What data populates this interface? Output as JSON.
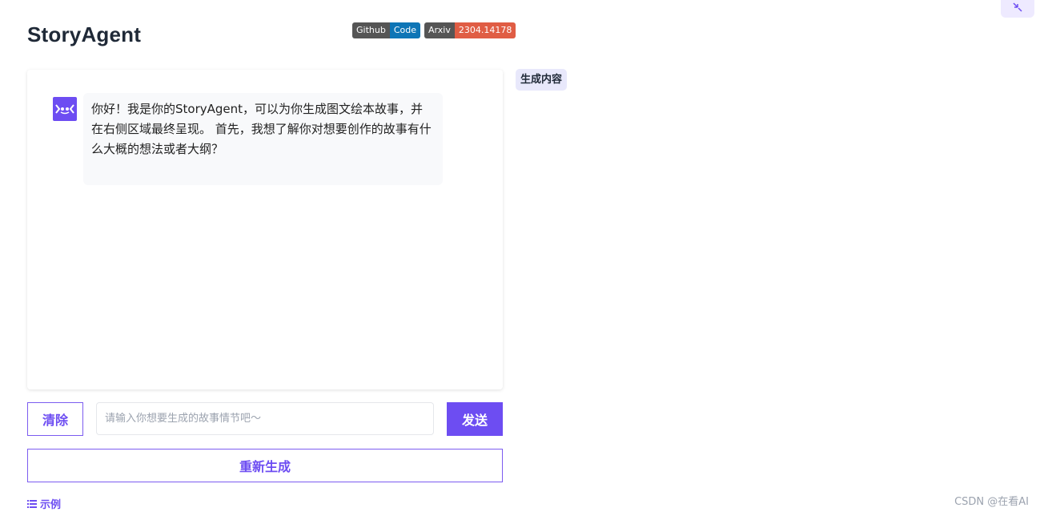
{
  "header": {
    "title": "StoryAgent",
    "badges": [
      {
        "left": "Github",
        "right": "Code",
        "right_color": "#0e75b6"
      },
      {
        "left": "Arxiv",
        "right": "2304.14178",
        "right_color": "#e05d44"
      }
    ]
  },
  "chat": {
    "messages": [
      {
        "role": "assistant",
        "avatar_icon": "robot-icon",
        "text": "你好！我是你的StoryAgent，可以为你生成图文绘本故事，并在右侧区域最终呈现。 首先，我想了解你对想要创作的故事有什么大概的想法或者大纲？"
      }
    ]
  },
  "output_panel": {
    "tag": "生成内容"
  },
  "controls": {
    "clear_label": "清除",
    "input_value": "",
    "input_placeholder": "请输入你想要生成的故事情节吧～",
    "send_label": "发送",
    "regenerate_label": "重新生成",
    "examples_label": "示例"
  },
  "corner": {
    "icon": "collapse-arrows-icon"
  },
  "watermark": "CSDN @在看AI",
  "colors": {
    "accent": "#6d4df2",
    "accent_border": "#7c5cf0"
  }
}
